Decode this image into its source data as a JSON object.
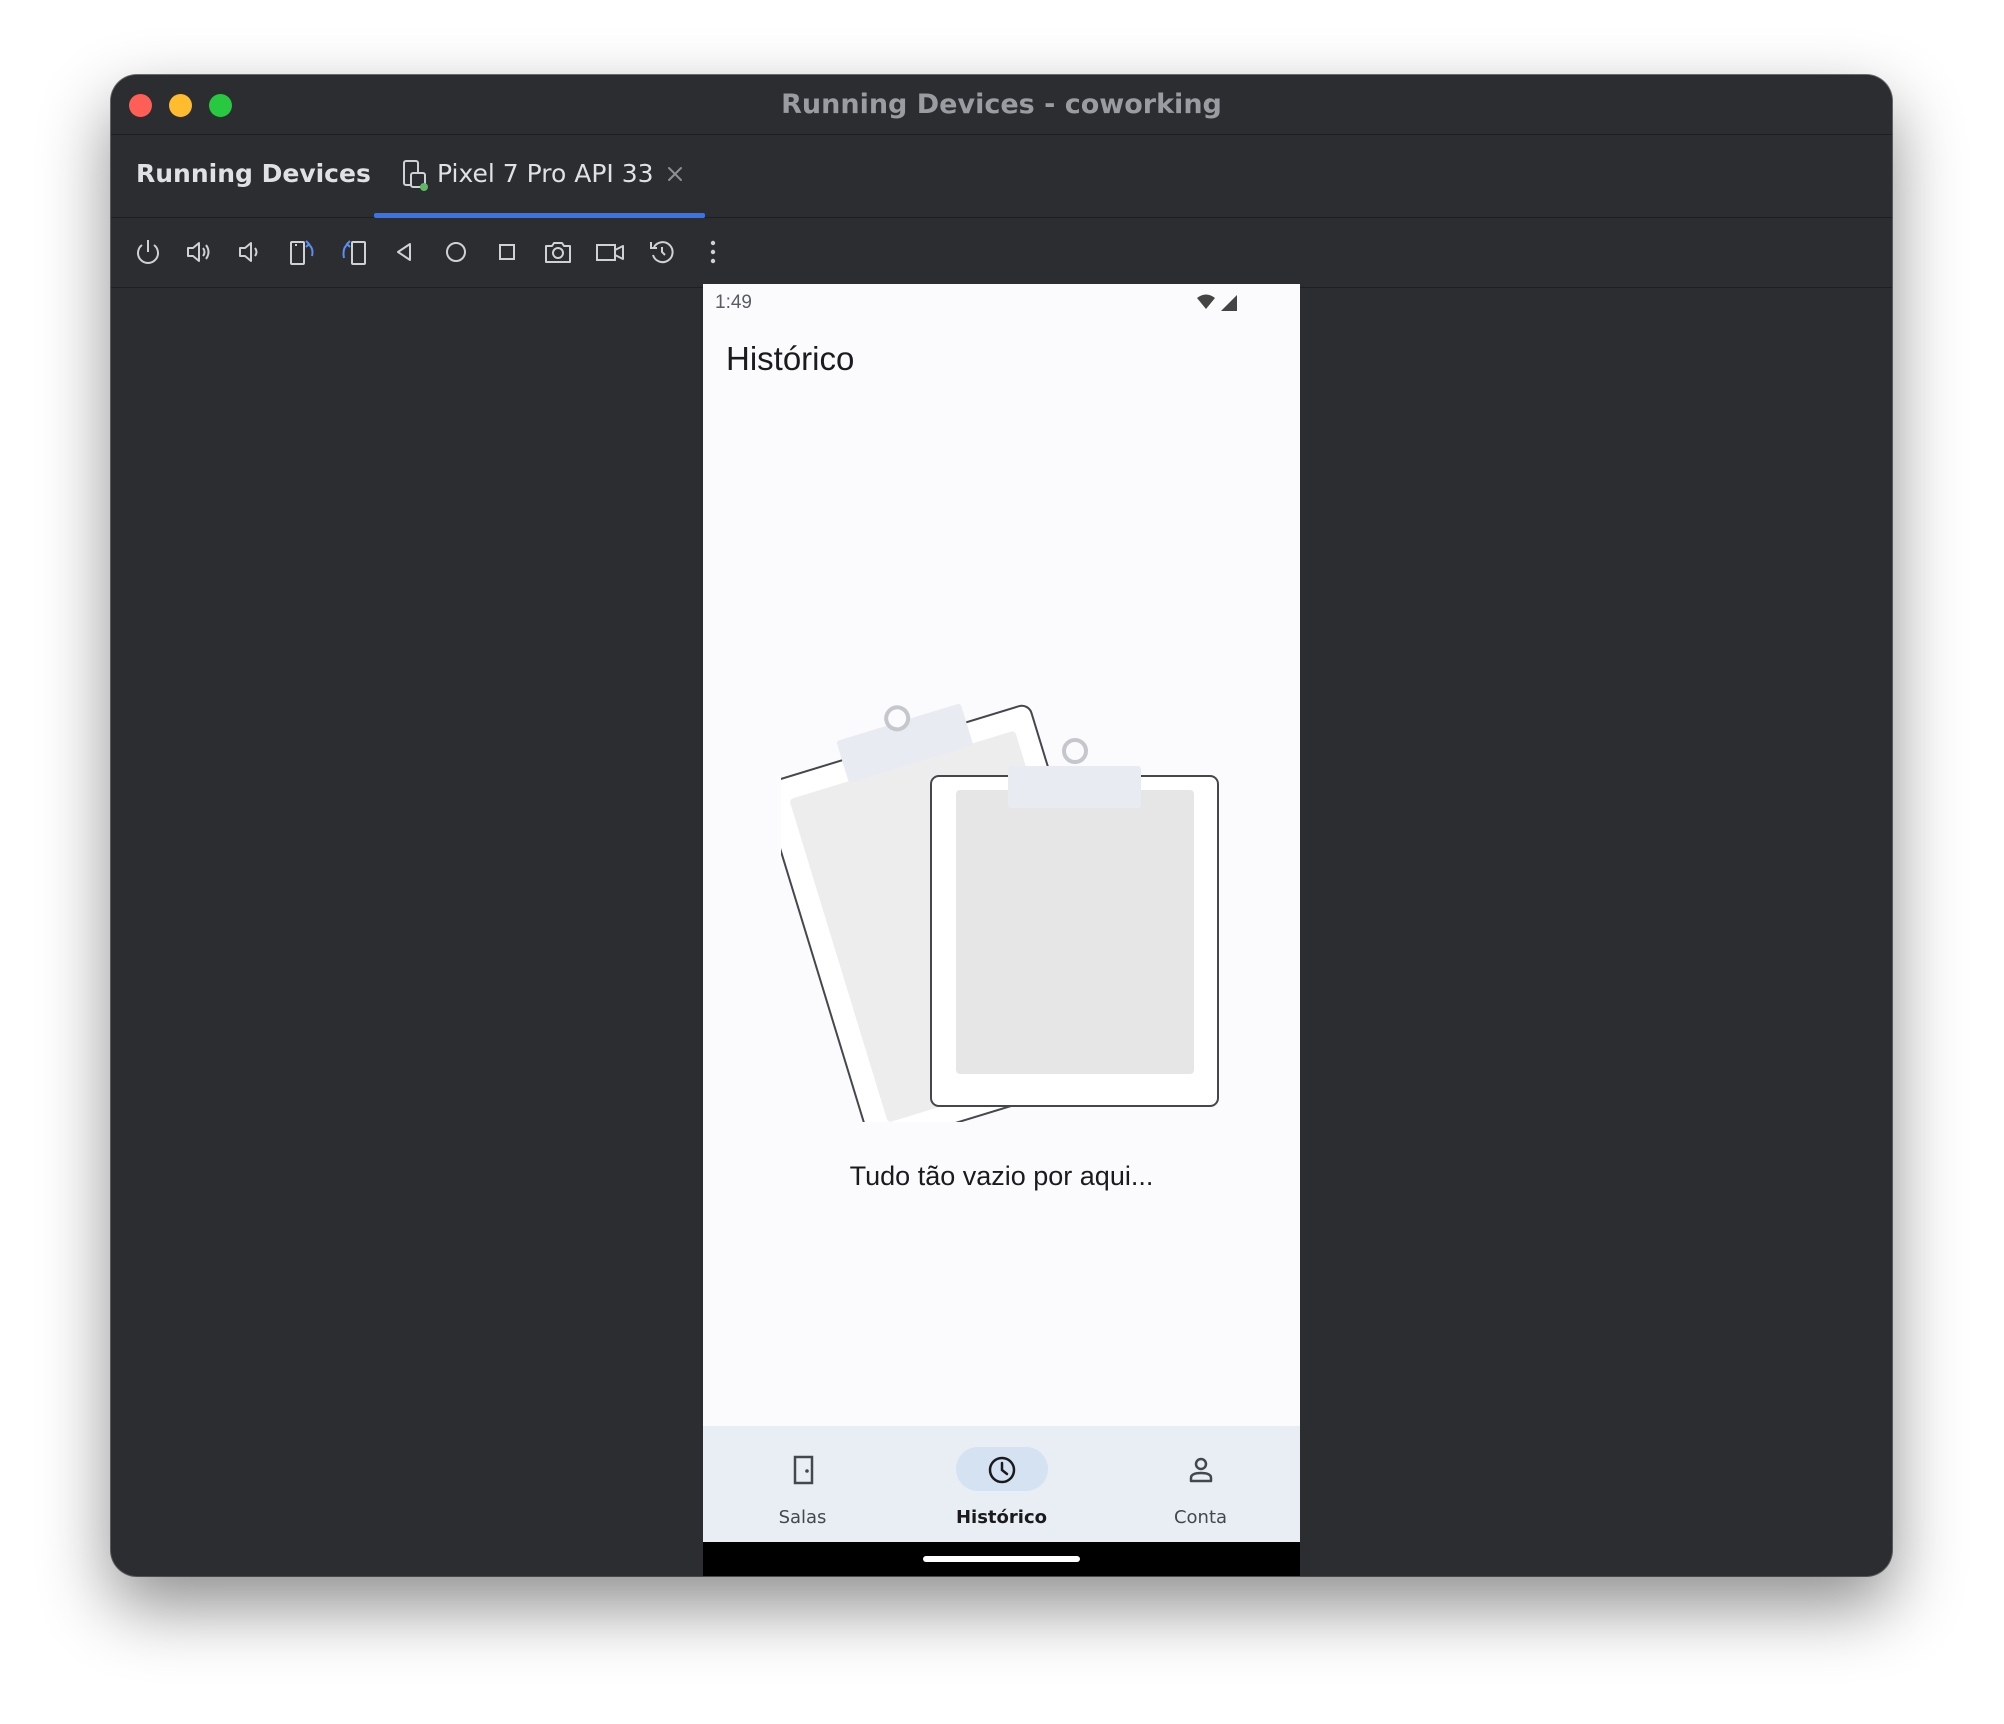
{
  "window": {
    "title": "Running Devices - coworking"
  },
  "tool_window": {
    "title": "Running Devices",
    "tab_label": "Pixel 7 Pro API 33"
  },
  "toolbar": {
    "buttons": [
      "power-icon",
      "volume-up-icon",
      "volume-down-icon",
      "rotate-left-icon",
      "rotate-right-icon",
      "back-icon",
      "home-icon",
      "overview-icon",
      "screenshot-icon",
      "screen-record-icon",
      "reset-icon",
      "more-options-icon"
    ]
  },
  "phone": {
    "status_time": "1:49",
    "screen_title": "Histórico",
    "empty_message": "Tudo tão vazio por aqui...",
    "nav": {
      "items": [
        {
          "label": "Salas",
          "icon": "door-icon",
          "active": false
        },
        {
          "label": "Histórico",
          "icon": "clock-icon",
          "active": true
        },
        {
          "label": "Conta",
          "icon": "person-icon",
          "active": false
        }
      ]
    }
  },
  "colors": {
    "window_bg": "#2b2d30",
    "tab_accent": "#3574f0",
    "nav_bg": "#e9eef5",
    "nav_active_indicator": "#d4e2f1"
  }
}
